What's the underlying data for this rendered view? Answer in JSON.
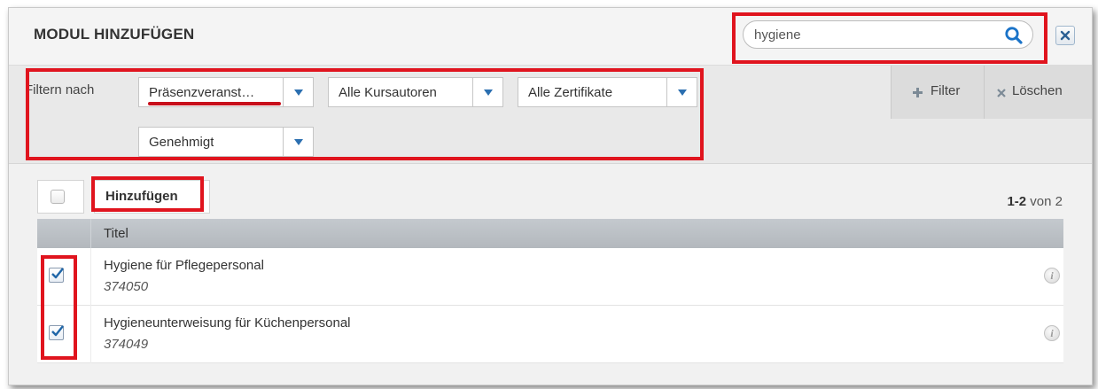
{
  "dialog": {
    "title": "MODUL HINZUFÜGEN",
    "close_icon": "close-icon",
    "search": {
      "value": "hygiene",
      "placeholder": "",
      "icon": "search-icon"
    }
  },
  "filters": {
    "label": "Filtern nach",
    "selects": [
      {
        "value": "Präsenzveranst…"
      },
      {
        "value": "Alle Kursautoren"
      },
      {
        "value": "Alle Zertifikate"
      },
      {
        "value": "Genehmigt"
      }
    ],
    "filter_button": {
      "icon": "plus-icon",
      "label": "Filter"
    },
    "clear_button": {
      "icon": "x-icon",
      "label": "Löschen"
    }
  },
  "toolbar": {
    "add_label": "Hinzufügen",
    "pager_range": "1-2",
    "pager_suffix": "von 2"
  },
  "table": {
    "columns": [
      "Titel"
    ],
    "rows": [
      {
        "title": "Hygiene für Pflegepersonal",
        "id": "374050",
        "checked": true
      },
      {
        "title": "Hygieneunterweisung für Küchenpersonal",
        "id": "374049",
        "checked": true
      }
    ]
  },
  "colors": {
    "highlight": "#e0141e",
    "accent_blue": "#1a73c8",
    "header_bg": "#f4f4f4",
    "filterbar_bg": "#e9e9e9"
  }
}
